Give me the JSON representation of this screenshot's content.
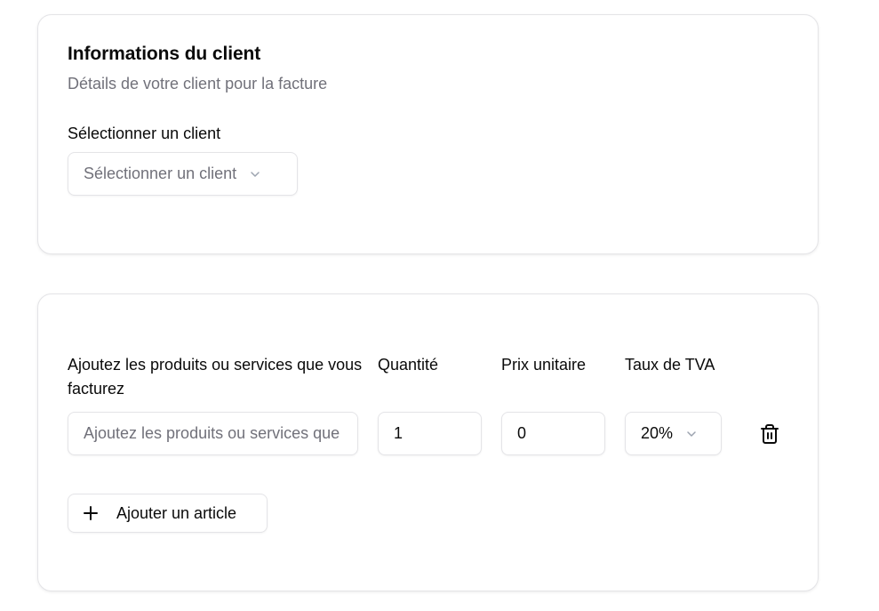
{
  "client_card": {
    "title": "Informations du client",
    "subtitle": "Détails de votre client pour la facture",
    "select_label": "Sélectionner un client",
    "select_placeholder": "Sélectionner un client"
  },
  "items_card": {
    "columns": {
      "description": "Ajoutez les produits ou services que vous facturez",
      "quantity": "Quantité",
      "unit_price": "Prix unitaire",
      "vat_rate": "Taux de TVA"
    },
    "row": {
      "description_placeholder": "Ajoutez les produits ou services que vous facturez",
      "quantity": "1",
      "unit_price": "0",
      "vat_rate": "20%"
    },
    "add_button_label": "Ajouter un article"
  },
  "icons": {
    "select_chevron": "chevron-down-icon",
    "vat_chevron": "chevron-down-icon",
    "delete": "trash-icon",
    "add": "plus-icon"
  },
  "colors": {
    "text": "#0a0a0a",
    "muted": "#71717a",
    "border": "#e4e4e7",
    "background": "#ffffff"
  }
}
